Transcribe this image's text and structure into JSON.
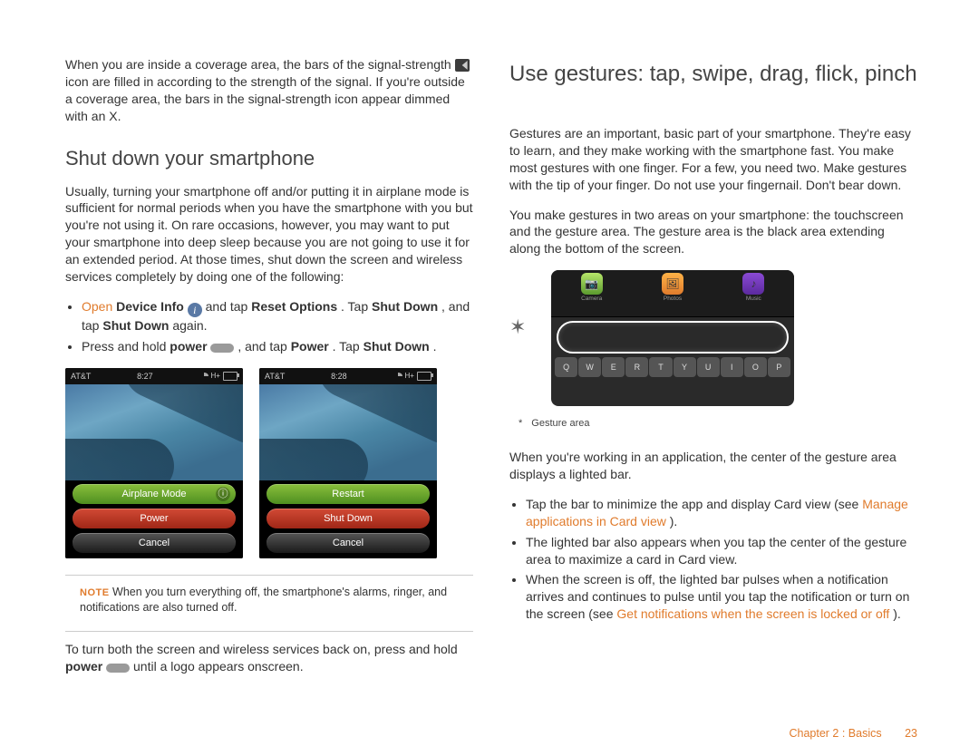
{
  "left": {
    "signal_para_a": "When you are inside a coverage area, the bars of the signal-strength ",
    "signal_para_b": " icon are filled in according to the strength of the signal. If you're outside a coverage area, the bars in the signal-strength icon appear dimmed with an X.",
    "h2": "Shut down your smartphone",
    "shutdown_para": "Usually, turning your smartphone off and/or putting it in airplane mode is sufficient for normal periods when you have the smartphone with you but you're not using it. On rare occasions, however, you may want to put your smartphone into deep sleep because you are not going to use it for an extended period. At those times, shut down the screen and wireless services completely by doing one of the following:",
    "bul1": {
      "open": "Open",
      "devinfo": "Device Info",
      "mid": " and tap ",
      "reset": "Reset Options",
      "dot": ". Tap ",
      "sd": "Shut Down",
      "tap2": ", and tap ",
      "sd2": "Shut Down",
      "again": " again."
    },
    "bul2": {
      "a": "Press and hold ",
      "power": "power",
      "b": " , and tap ",
      "pw": "Power",
      "c": ". Tap ",
      "sd": "Shut Down",
      "d": "."
    },
    "phone1": {
      "carrier": "AT&T",
      "time": "8:27",
      "btnA": "Airplane Mode",
      "btnB": "Power",
      "btnC": "Cancel"
    },
    "phone2": {
      "carrier": "AT&T",
      "time": "8:28",
      "btnA": "Restart",
      "btnB": "Shut Down",
      "btnC": "Cancel"
    },
    "note_label": "NOTE",
    "note_text": "  When you turn everything off, the smartphone's alarms, ringer, and notifications are also turned off.",
    "turnon_a": "To turn both the screen and wireless services back on, press and hold ",
    "turnon_power": "power",
    "turnon_b": "  until a logo appears onscreen."
  },
  "right": {
    "h1": "Use gestures: tap, swipe, drag, flick, pinch",
    "p1": "Gestures are an important, basic part of your smartphone. They're easy to learn, and they make working with the smartphone fast. You make most gestures with one finger. For a few, you need two. Make gestures with the tip of your finger. Do not use your fingernail. Don't bear down.",
    "p2": "You make gestures in two areas on your smartphone: the touchscreen and the gesture area. The gesture area is the black area extending along the bottom of the screen.",
    "icons": {
      "camera": "Camera",
      "photos": "Photos",
      "music": "Music"
    },
    "keys": [
      "Q",
      "W",
      "E",
      "R",
      "T",
      "Y",
      "U",
      "I",
      "O",
      "P"
    ],
    "caption": "Gesture area",
    "p3": "When you're working in an application, the center of the gesture area displays a lighted bar.",
    "b1a": "Tap the bar to minimize the app and display Card view (see ",
    "b1link": "Manage applications in Card view",
    "b1b": ").",
    "b2": "The lighted bar also appears when you tap the center of the gesture area to maximize a card in Card view.",
    "b3a": "When the screen is off, the lighted bar pulses when a notification arrives and continues to pulse until you tap the notification or turn on the screen (see ",
    "b3link": "Get notifications when the screen is locked or off",
    "b3b": ")."
  },
  "footer": {
    "chapter": "Chapter 2 : Basics",
    "page": "23"
  }
}
